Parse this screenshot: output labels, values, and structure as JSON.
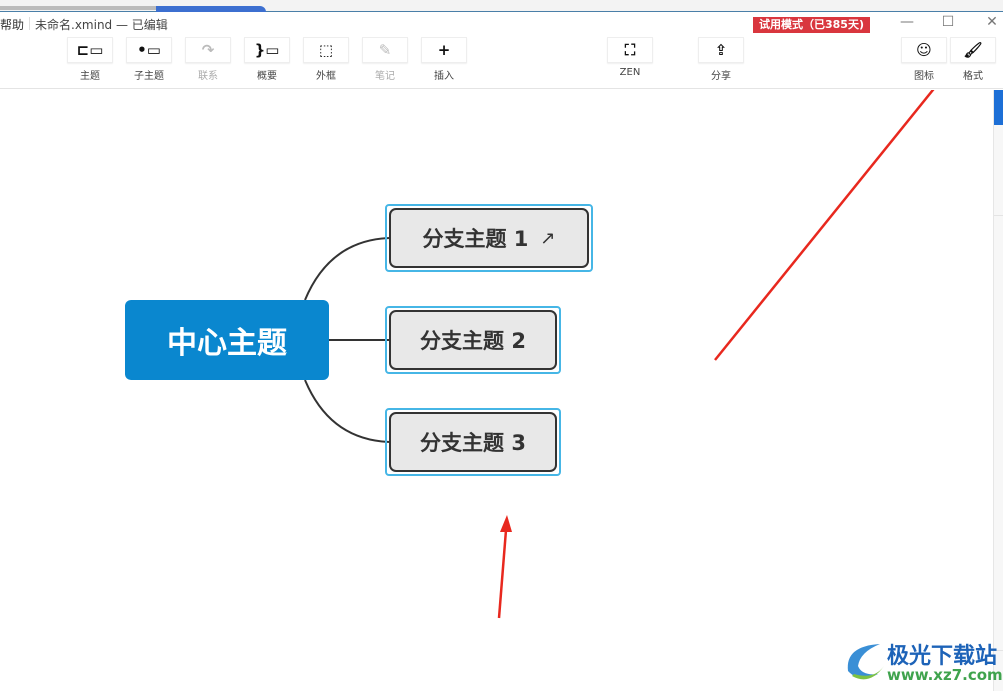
{
  "titlebar": {
    "menu": "帮助",
    "file": "未命名.xmind — 已编辑",
    "trial": "试用模式（已385天)"
  },
  "toolbar": {
    "items": [
      {
        "label": "主题",
        "icon": "topic-icon",
        "glyph": "⊏▭"
      },
      {
        "label": "子主题",
        "icon": "subtopic-icon",
        "glyph": "•▭"
      },
      {
        "label": "联系",
        "icon": "relationship-icon",
        "glyph": "↷",
        "disabled": true
      },
      {
        "label": "概要",
        "icon": "summary-icon",
        "glyph": "}▭"
      },
      {
        "label": "外框",
        "icon": "boundary-icon",
        "glyph": "⬚"
      },
      {
        "label": "笔记",
        "icon": "note-icon",
        "glyph": "✎",
        "disabled": true
      },
      {
        "label": "插入",
        "icon": "plus-icon",
        "glyph": "+"
      },
      {
        "label": "ZEN",
        "icon": "fullscreen-icon",
        "glyph": "⛶"
      },
      {
        "label": "分享",
        "icon": "share-icon",
        "glyph": "⇪"
      },
      {
        "label": "图标",
        "icon": "smiley-icon",
        "glyph": "☺"
      },
      {
        "label": "格式",
        "icon": "paint-brush-icon",
        "glyph": "🖌"
      }
    ]
  },
  "mindmap": {
    "central": "中心主题",
    "branches": [
      "分支主题 1",
      "分支主题 2",
      "分支主题 3"
    ],
    "branch1_icon": "external-link-icon"
  },
  "watermark": {
    "title": "极光下载站",
    "url": "www.xz7.com"
  },
  "colors": {
    "central": "#0a87cf",
    "selection": "#46b6e6",
    "trial": "#d9363e",
    "arrow": "#e8281e"
  }
}
